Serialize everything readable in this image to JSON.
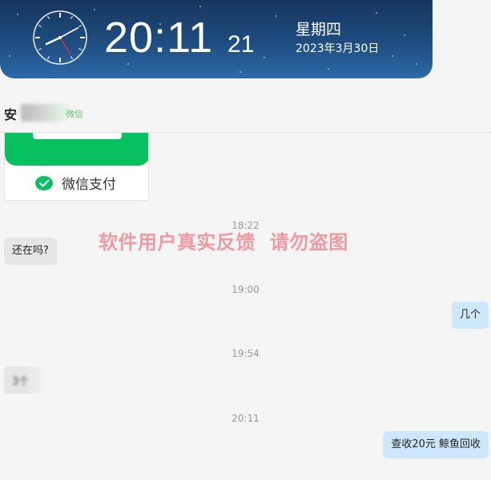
{
  "clock": {
    "time": "20:11",
    "seconds": "21",
    "weekday": "星期四",
    "date": "2023年3月30日"
  },
  "header": {
    "contact_name": "安",
    "contact_tag": "微信"
  },
  "pay_card": {
    "label": "微信支付",
    "brand_color": "#07c160",
    "icon": "wechat-pay-icon"
  },
  "messages": [
    {
      "type": "timestamp",
      "text": "18:22"
    },
    {
      "type": "incoming",
      "text": "还在吗?"
    },
    {
      "type": "timestamp",
      "text": "19:00"
    },
    {
      "type": "outgoing",
      "text": "几个"
    },
    {
      "type": "timestamp",
      "text": "19:54"
    },
    {
      "type": "incoming",
      "text": "3个",
      "redacted": true
    },
    {
      "type": "timestamp",
      "text": "20:11"
    },
    {
      "type": "outgoing",
      "text": "查收20元 鲸鱼回收"
    }
  ],
  "watermark": "软件用户真实反馈  请勿盗图",
  "colors": {
    "banner": "#1f4d80",
    "incoming_bubble": "#e6e6e6",
    "outgoing_bubble": "#cde7fb",
    "watermark": "#ef8b93"
  }
}
